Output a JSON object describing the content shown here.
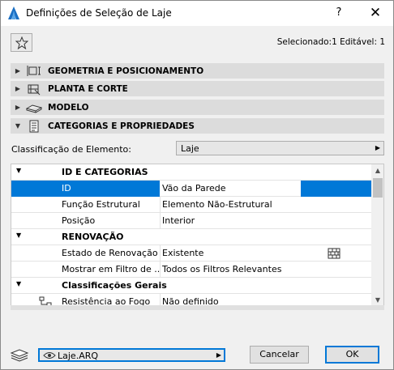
{
  "window": {
    "title": "Definições de Seleção de Laje",
    "help_label": "?",
    "close_label": "✕"
  },
  "selection_info": "Selecionado:1 Editável: 1",
  "sections": [
    {
      "label": "GEOMETRIA E POSICIONAMENTO",
      "icon": "geometry-icon",
      "expanded": false
    },
    {
      "label": "PLANTA E CORTE",
      "icon": "floorplan-section-icon",
      "expanded": false
    },
    {
      "label": "MODELO",
      "icon": "model-icon",
      "expanded": false
    },
    {
      "label": "CATEGORIAS E PROPRIEDADES",
      "icon": "categories-icon",
      "expanded": true
    }
  ],
  "classification": {
    "label": "Classificação de Elemento:",
    "value": "Laje"
  },
  "grid": {
    "rows": [
      {
        "type": "group",
        "label": "ID E CATEGORIAS"
      },
      {
        "type": "item",
        "label": "ID",
        "value": "Vão da Parede",
        "selected": true
      },
      {
        "type": "item",
        "label": "Função Estrutural",
        "value": "Elemento Não-Estrutural"
      },
      {
        "type": "item",
        "label": "Posição",
        "value": "Interior"
      },
      {
        "type": "group",
        "label": "RENOVAÇÃO"
      },
      {
        "type": "item",
        "label": "Estado de Renovação",
        "value": "Existente",
        "icon": "renovation-brick-icon"
      },
      {
        "type": "item",
        "label": "Mostrar em Filtro de ...",
        "value": "Todos os Filtros Relevantes"
      },
      {
        "type": "group",
        "label": "Classificações Gerais"
      },
      {
        "type": "item",
        "label": "Resistência ao Fogo",
        "value": "Não definido",
        "icon": "classification-tree-icon"
      }
    ]
  },
  "layer": {
    "value": "Laje.ARQ"
  },
  "buttons": {
    "cancel": "Cancelar",
    "ok": "OK"
  }
}
